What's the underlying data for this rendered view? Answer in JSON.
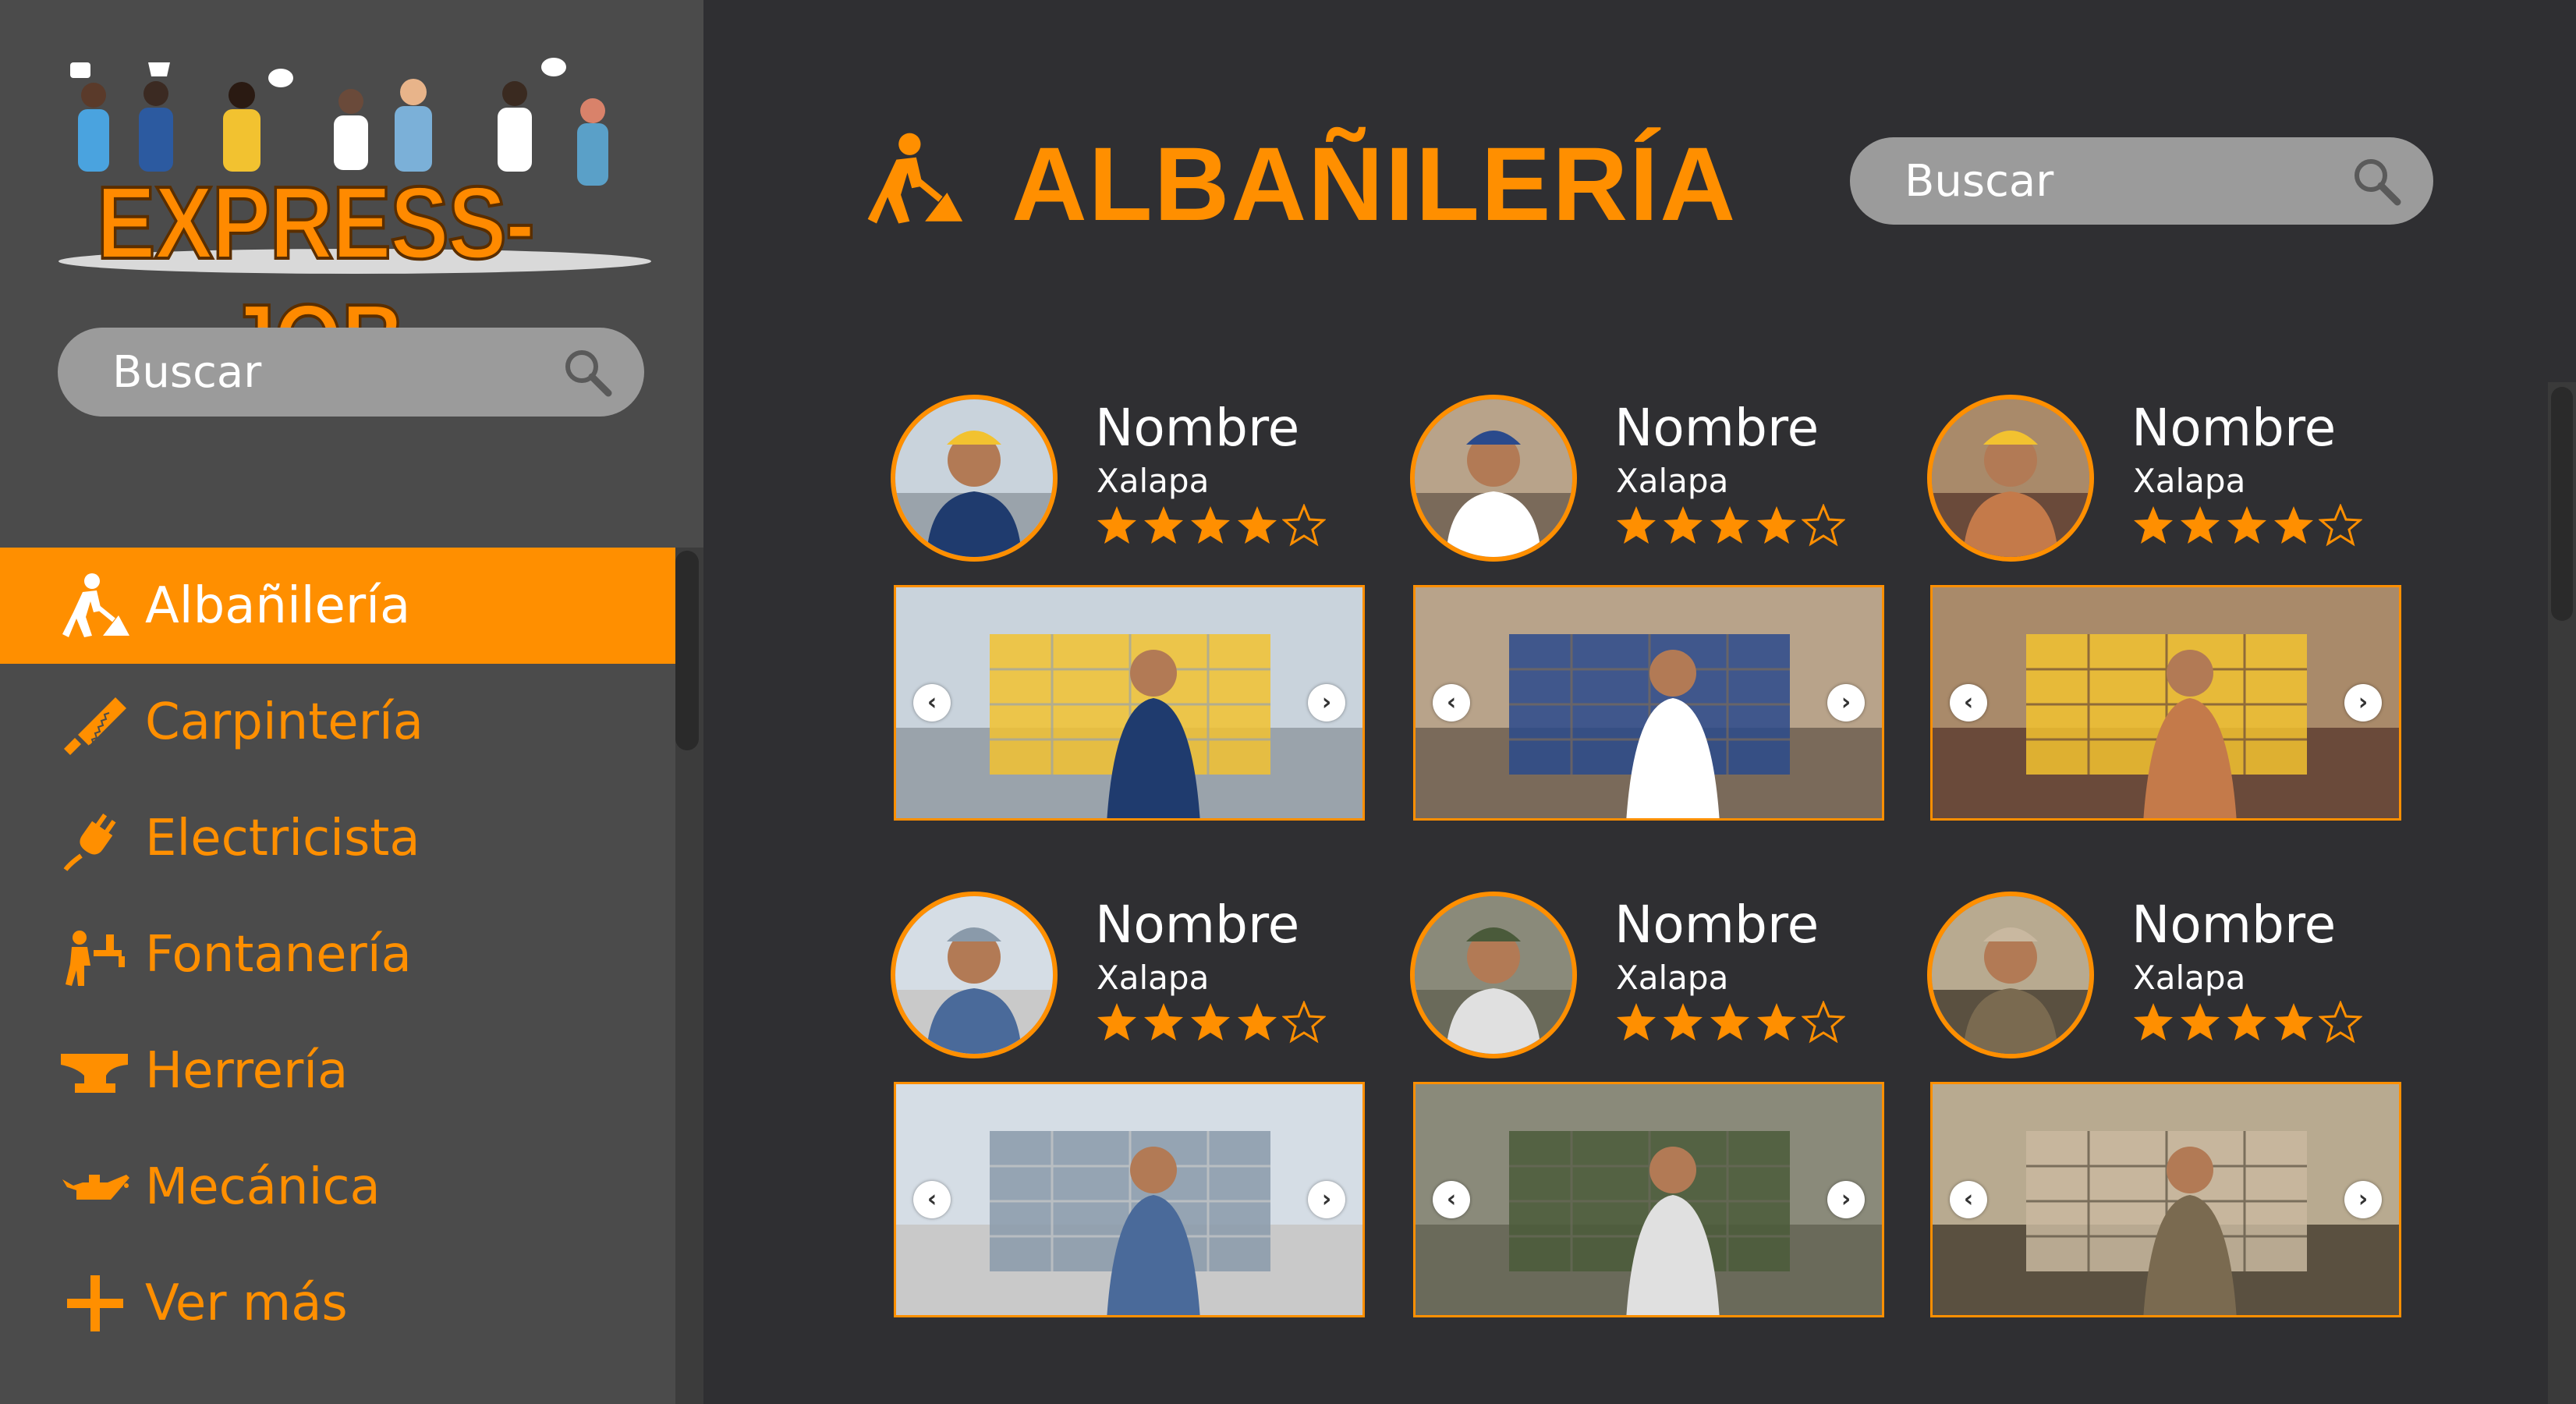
{
  "logo": {
    "text": "EXPRESS-JOB"
  },
  "sidebar": {
    "search_placeholder": "Buscar",
    "items": [
      {
        "label": "Albañilería",
        "icon": "mason-icon",
        "active": true
      },
      {
        "label": "Carpintería",
        "icon": "saw-icon",
        "active": false
      },
      {
        "label": "Electricista",
        "icon": "plug-icon",
        "active": false
      },
      {
        "label": "Fontanería",
        "icon": "plumber-icon",
        "active": false
      },
      {
        "label": "Herrería",
        "icon": "anvil-icon",
        "active": false
      },
      {
        "label": "Mecánica",
        "icon": "oil-can-icon",
        "active": false
      },
      {
        "label": "Ver más",
        "icon": "plus-icon",
        "active": false
      }
    ]
  },
  "main": {
    "title": "ALBAÑILERÍA",
    "title_icon": "mason-icon",
    "search_placeholder": "Buscar"
  },
  "workers": [
    {
      "name": "Nombre",
      "city": "Xalapa",
      "rating": 4,
      "max_rating": 5
    },
    {
      "name": "Nombre",
      "city": "Xalapa",
      "rating": 4,
      "max_rating": 5
    },
    {
      "name": "Nombre",
      "city": "Xalapa",
      "rating": 4,
      "max_rating": 5
    },
    {
      "name": "Nombre",
      "city": "Xalapa",
      "rating": 4,
      "max_rating": 5
    },
    {
      "name": "Nombre",
      "city": "Xalapa",
      "rating": 4,
      "max_rating": 5
    },
    {
      "name": "Nombre",
      "city": "Xalapa",
      "rating": 4,
      "max_rating": 5
    }
  ],
  "colors": {
    "accent": "#ff8f00",
    "sidebar_bg": "#4b4b4b",
    "main_bg": "#2f2f32",
    "search_bg": "#9b9b9b"
  }
}
